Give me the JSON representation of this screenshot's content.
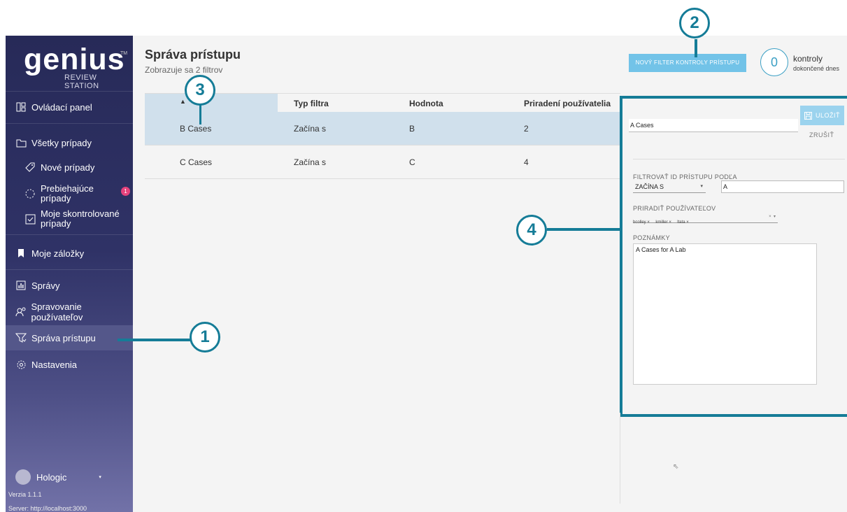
{
  "sidebar": {
    "logo": "genius",
    "logo_tm": "TM",
    "logo_sub": "REVIEW STATION",
    "items": [
      {
        "label": "Ovládací panel",
        "icon": "dashboard-icon"
      },
      {
        "label": "Všetky prípady",
        "icon": "folder-icon"
      },
      {
        "label": "Nové prípady",
        "icon": "tag-icon"
      },
      {
        "label": "Prebiehajúce prípady",
        "icon": "progress-icon",
        "badge": "1"
      },
      {
        "label": "Moje skontrolované prípady",
        "icon": "checkbox-icon"
      },
      {
        "label": "Moje záložky",
        "icon": "bookmark-icon"
      },
      {
        "label": "Správy",
        "icon": "chart-icon"
      },
      {
        "label": "Spravovanie používateľov",
        "icon": "users-icon"
      },
      {
        "label": "Správa prístupu",
        "icon": "filter-icon",
        "active": true
      },
      {
        "label": "Nastavenia",
        "icon": "gear-icon"
      }
    ],
    "user_name": "Hologic",
    "version": "Verzia 1.1.1",
    "server": "Server: http://localhost:3000"
  },
  "header": {
    "title": "Správa prístupu",
    "subtitle": "Zobrazuje sa 2 filtrov",
    "new_filter_button": "NOVÝ FILTER KONTROLY PRÍSTUPU",
    "counter_value": "0",
    "counter_label_1": "kontroly",
    "counter_label_2": "dokončené dnes"
  },
  "table": {
    "columns": [
      "",
      "Typ filtra",
      "Hodnota",
      "Priradení používatelia"
    ],
    "rows": [
      [
        "B Cases",
        "Začína s",
        "B",
        "2"
      ],
      [
        "C Cases",
        "Začína s",
        "C",
        "4"
      ]
    ]
  },
  "edit_panel": {
    "name_value": "A Cases",
    "save_label": "ULOŽIŤ",
    "cancel_label": "ZRUŠIŤ",
    "filter_label": "FILTROVAŤ ID PRÍSTUPU PODĽA",
    "filter_select": "ZAČÍNA S",
    "filter_value": "A",
    "assign_label": "PRIRADIŤ POUŽÍVATEĽOV",
    "assigned_users": [
      "bcolley",
      "kmiller",
      "ltata"
    ],
    "notes_label": "POZNÁMKY",
    "notes_value": "A Cases for A Lab"
  },
  "callouts": [
    "1",
    "2",
    "3",
    "4"
  ],
  "colors": {
    "accent": "#157c97",
    "button": "#72c3e8",
    "sidebar": "#2f3266",
    "badge": "#e4427c",
    "selected_row": "#d0e0ec"
  }
}
